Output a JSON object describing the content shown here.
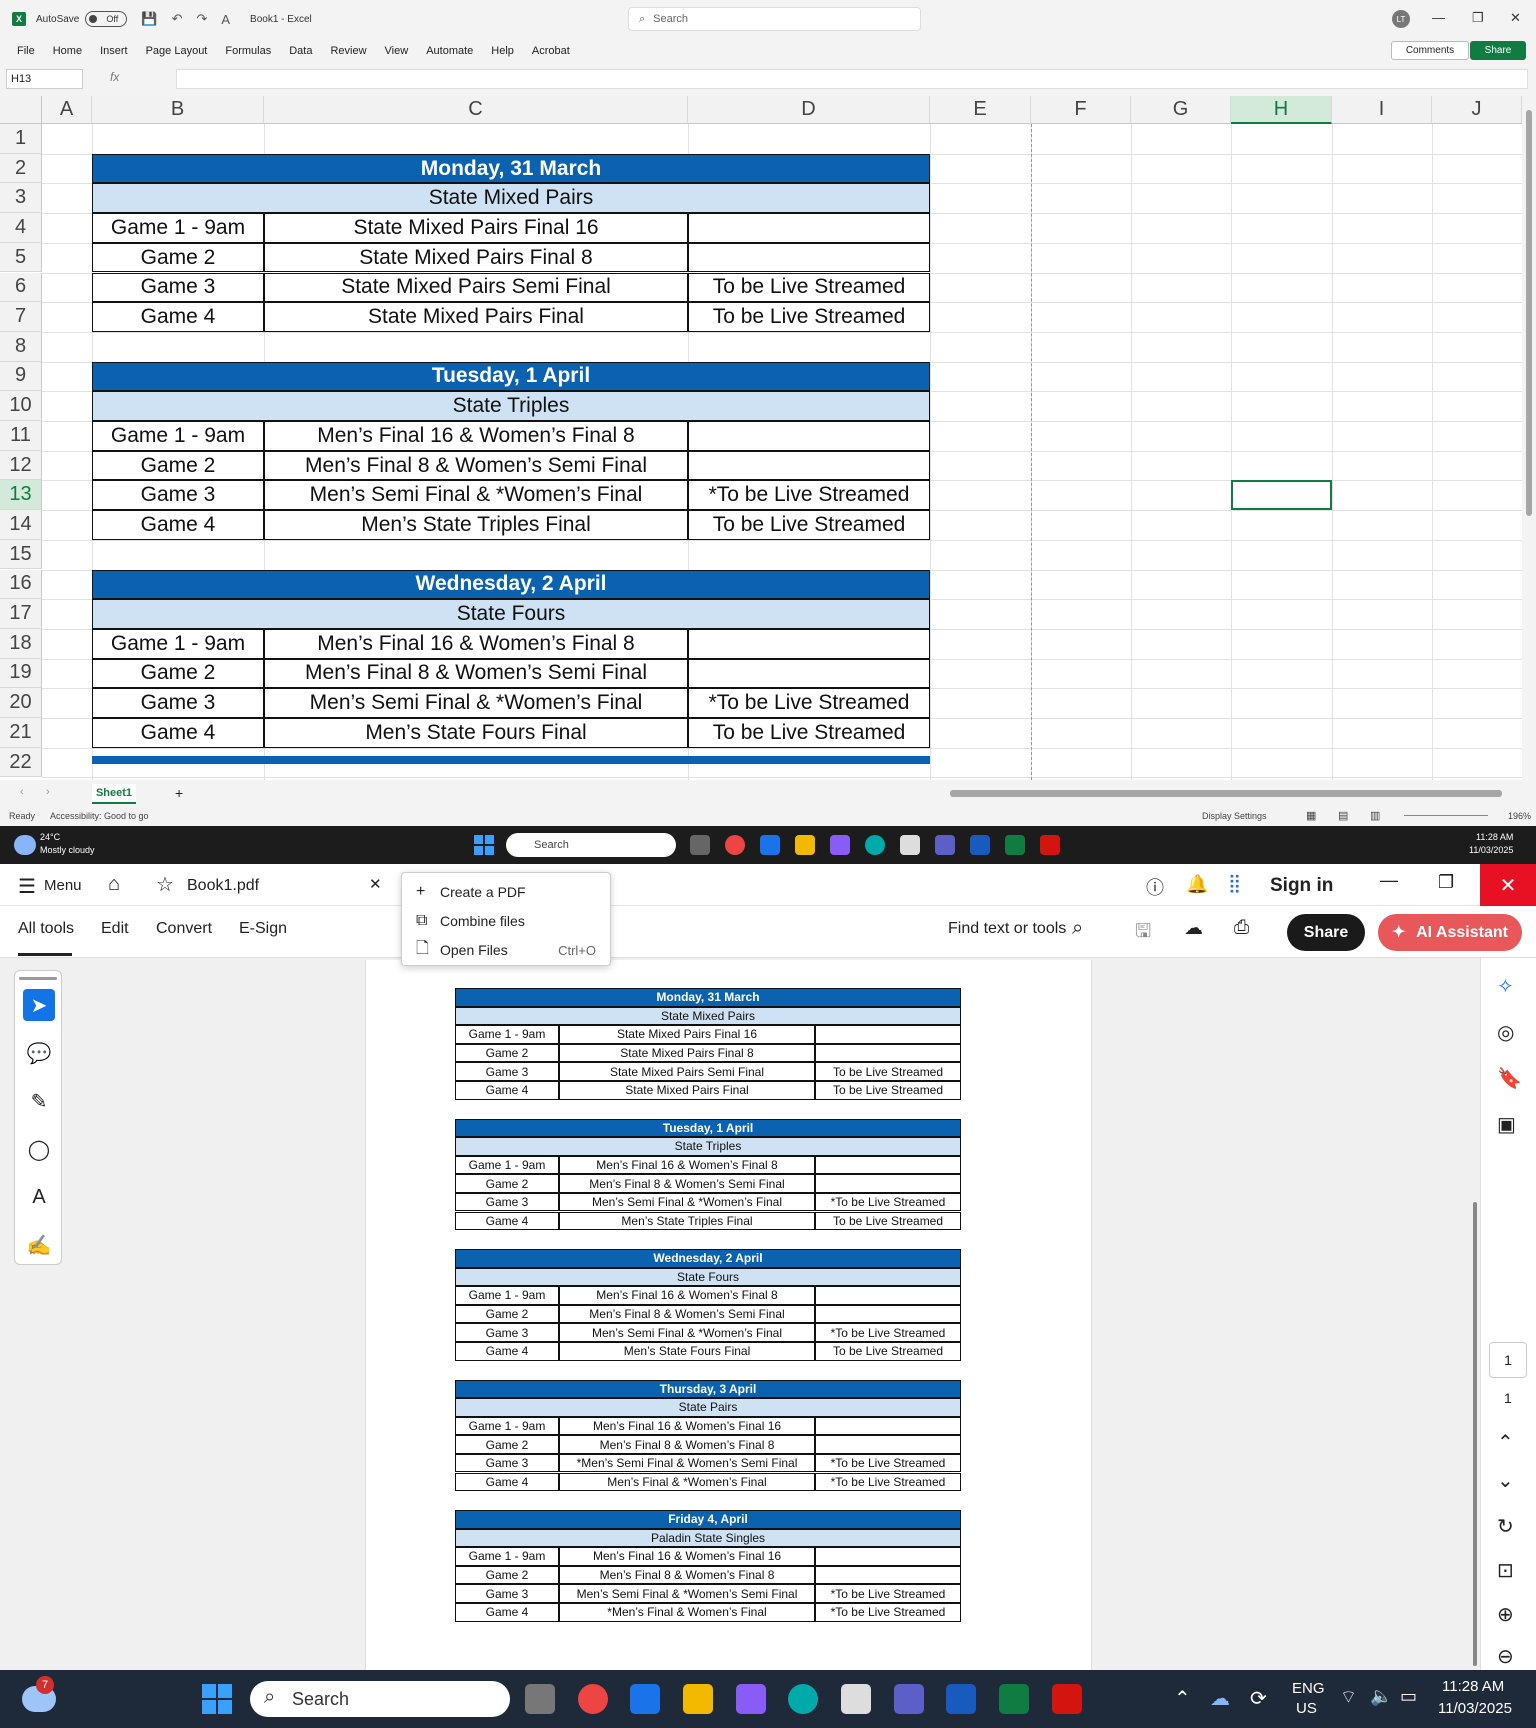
{
  "excel": {
    "autosave_label": "AutoSave",
    "autosave_state": "Off",
    "doc_title": "Book1 - Excel",
    "search_placeholder": "Search",
    "user_initials": "LT",
    "menu": [
      "File",
      "Home",
      "Insert",
      "Page Layout",
      "Formulas",
      "Data",
      "Review",
      "View",
      "Automate",
      "Help",
      "Acrobat"
    ],
    "comments": "Comments",
    "share": "Share",
    "namebox": "H13",
    "fx": "fx",
    "columns": [
      "A",
      "B",
      "C",
      "D",
      "E",
      "F",
      "G",
      "H",
      "I",
      "J"
    ],
    "rows": [
      "1",
      "2",
      "3",
      "4",
      "5",
      "6",
      "7",
      "8",
      "9",
      "10",
      "11",
      "12",
      "13",
      "14",
      "15",
      "16",
      "17",
      "18",
      "19",
      "20",
      "21",
      "22"
    ],
    "sheet_tab": "Sheet1",
    "status_ready": "Ready",
    "accessibility": "Accessibility: Good to go",
    "display_settings": "Display Settings",
    "zoom": "196%"
  },
  "schedule_excel": [
    {
      "day": "Monday, 31 March",
      "event": "State Mixed Pairs",
      "games": [
        [
          "Game 1 - 9am",
          "State Mixed Pairs Final 16",
          ""
        ],
        [
          "Game 2",
          "State Mixed Pairs Final 8",
          ""
        ],
        [
          "Game 3",
          "State Mixed Pairs Semi Final",
          "To be Live Streamed"
        ],
        [
          "Game 4",
          "State Mixed Pairs Final",
          "To be Live Streamed"
        ]
      ]
    },
    {
      "day": "Tuesday, 1 April",
      "event": "State Triples",
      "games": [
        [
          "Game 1 - 9am",
          "Men’s Final 16 & Women’s Final 8",
          ""
        ],
        [
          "Game 2",
          "Men’s Final 8 & Women’s Semi Final",
          ""
        ],
        [
          "Game 3",
          "Men’s Semi Final & *Women’s Final",
          "*To be Live Streamed"
        ],
        [
          "Game 4",
          "Men’s State Triples Final",
          "To be Live Streamed"
        ]
      ]
    },
    {
      "day": "Wednesday, 2 April",
      "event": "State Fours",
      "games": [
        [
          "Game 1 - 9am",
          "Men’s Final 16 & Women’s Final 8",
          ""
        ],
        [
          "Game 2",
          "Men’s Final 8 & Women’s Semi Final",
          ""
        ],
        [
          "Game 3",
          "Men’s Semi Final & *Women’s Final",
          "*To be Live Streamed"
        ],
        [
          "Game 4",
          "Men’s State Fours Final",
          "To be Live Streamed"
        ]
      ]
    }
  ],
  "taskbar_small": {
    "temp": "24°C",
    "weather": "Mostly cloudy",
    "search": "Search",
    "time": "11:28 AM",
    "date": "11/03/2025"
  },
  "acrobat": {
    "menu": "Menu",
    "tab_title": "Book1.pdf",
    "sign_in": "Sign in",
    "tabs": [
      "All tools",
      "Edit",
      "Convert",
      "E-Sign"
    ],
    "find": "Find text or tools",
    "share": "Share",
    "ai": "AI Assistant",
    "dropdown": [
      {
        "label": "Create a PDF",
        "shortcut": ""
      },
      {
        "label": "Combine files",
        "shortcut": ""
      },
      {
        "label": "Open Files",
        "shortcut": "Ctrl+O"
      }
    ],
    "page_num": "1",
    "page_total": "1"
  },
  "schedule_pdf": [
    {
      "day": "Monday, 31 March",
      "event": "State Mixed Pairs",
      "games": [
        [
          "Game 1 - 9am",
          "State Mixed Pairs Final 16",
          ""
        ],
        [
          "Game 2",
          "State Mixed Pairs Final 8",
          ""
        ],
        [
          "Game 3",
          "State Mixed Pairs Semi Final",
          "To be Live Streamed"
        ],
        [
          "Game 4",
          "State Mixed Pairs Final",
          "To be Live Streamed"
        ]
      ]
    },
    {
      "day": "Tuesday, 1 April",
      "event": "State Triples",
      "games": [
        [
          "Game 1 - 9am",
          "Men’s Final 16 & Women’s Final 8",
          ""
        ],
        [
          "Game 2",
          "Men’s Final 8 & Women’s Semi Final",
          ""
        ],
        [
          "Game 3",
          "Men’s Semi Final & *Women’s Final",
          "*To be Live Streamed"
        ],
        [
          "Game 4",
          "Men’s State Triples Final",
          "To be Live Streamed"
        ]
      ]
    },
    {
      "day": "Wednesday, 2 April",
      "event": "State Fours",
      "games": [
        [
          "Game 1 - 9am",
          "Men’s Final 16 & Women’s Final 8",
          ""
        ],
        [
          "Game 2",
          "Men’s Final 8 & Women’s Semi Final",
          ""
        ],
        [
          "Game 3",
          "Men’s Semi Final & *Women’s Final",
          "*To be Live Streamed"
        ],
        [
          "Game 4",
          "Men’s State Fours Final",
          "To be Live Streamed"
        ]
      ]
    },
    {
      "day": "Thursday, 3 April",
      "event": "State Pairs",
      "games": [
        [
          "Game 1 - 9am",
          "Men’s Final 16 & Women’s Final 16",
          ""
        ],
        [
          "Game 2",
          "Men’s Final 8 & Women’s Final 8",
          ""
        ],
        [
          "Game 3",
          "*Men’s Semi Final & Women’s Semi Final",
          "*To be Live Streamed"
        ],
        [
          "Game 4",
          "Men’s Final & *Women’s Final",
          "*To be Live Streamed"
        ]
      ]
    },
    {
      "day": "Friday 4, April",
      "event": "Paladin State Singles",
      "games": [
        [
          "Game 1 - 9am",
          "Men’s Final 16 & Women’s Final 16",
          ""
        ],
        [
          "Game 2",
          "Men’s Final 8 & Women’s Final 8",
          ""
        ],
        [
          "Game 3",
          "Men’s Semi Final & *Women’s Semi Final",
          "*To be Live Streamed"
        ],
        [
          "Game 4",
          "*Men’s Final & Women’s Final",
          "*To be Live Streamed"
        ]
      ]
    }
  ],
  "taskbar": {
    "search": "Search",
    "lang1": "ENG",
    "lang2": "US",
    "time": "11:28 AM",
    "date": "11/03/2025",
    "badge": "7"
  }
}
